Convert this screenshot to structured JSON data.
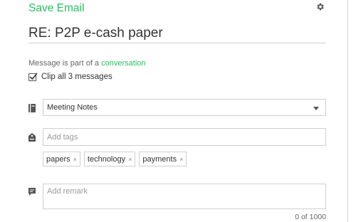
{
  "header": {
    "app_title": "Save Email"
  },
  "email": {
    "title": "RE: P2P e-cash paper"
  },
  "conversation": {
    "prefix": "Message is part of a",
    "link": "conversation"
  },
  "clip": {
    "label": "Clip all 3 messages",
    "checked": true
  },
  "notebook": {
    "selected": "Meeting Notes"
  },
  "tags": {
    "placeholder": "Add tags",
    "items": [
      {
        "label": "papers"
      },
      {
        "label": "technology"
      },
      {
        "label": "payments"
      }
    ],
    "remove_glyph": "×"
  },
  "remark": {
    "placeholder": "Add remark",
    "counter": "0 of 1000"
  },
  "colors": {
    "accent": "#2dbe60",
    "icon": "#555555",
    "border": "#cfcfcf"
  },
  "icons": {
    "settings": "gear-icon",
    "notebook": "notebook-icon",
    "tags": "tag-icon",
    "remark": "comment-icon"
  }
}
